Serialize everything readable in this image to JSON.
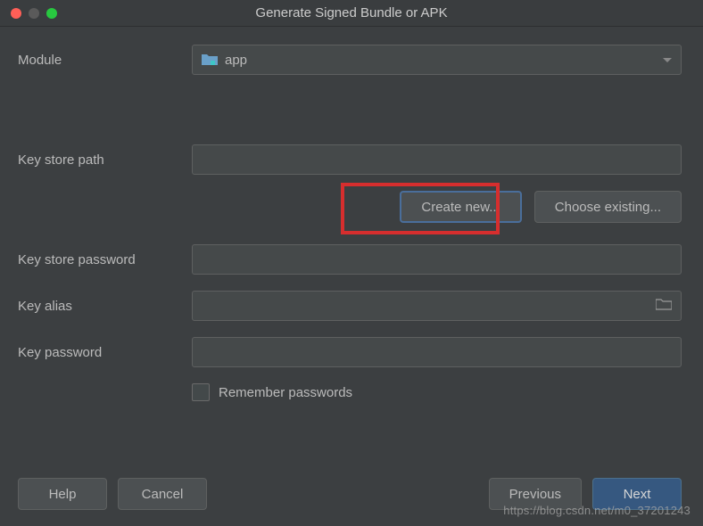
{
  "titlebar": {
    "title": "Generate Signed Bundle or APK"
  },
  "form": {
    "module_label": "Module",
    "module_value": "app",
    "keystore_path_label": "Key store path",
    "keystore_path_value": "",
    "create_new_label": "Create new...",
    "choose_existing_label": "Choose existing...",
    "keystore_password_label": "Key store password",
    "keystore_password_value": "",
    "key_alias_label": "Key alias",
    "key_alias_value": "",
    "key_password_label": "Key password",
    "key_password_value": "",
    "remember_passwords_label": "Remember passwords",
    "remember_passwords_checked": false
  },
  "footer": {
    "help_label": "Help",
    "cancel_label": "Cancel",
    "previous_label": "Previous",
    "next_label": "Next"
  },
  "watermark": "https://blog.csdn.net/m0_37201243"
}
